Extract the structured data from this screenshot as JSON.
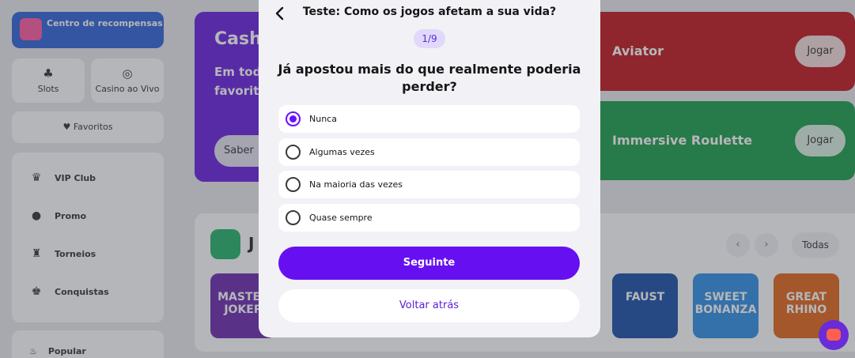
{
  "sidebar": {
    "rewards_label": "Centro de recompensas",
    "tiles": [
      {
        "label": "Slots",
        "icon": "cherries-icon"
      },
      {
        "label": "Casino ao Vivo",
        "icon": "chip-icon"
      }
    ],
    "favorites_label": "Favoritos",
    "menu": [
      {
        "label": "VIP Club",
        "icon": "crown-icon"
      },
      {
        "label": "Promo",
        "icon": "promo-icon"
      },
      {
        "label": "Torneios",
        "icon": "trophy-icon"
      },
      {
        "label": "Conquistas",
        "icon": "achievement-icon"
      }
    ],
    "popular_label": "Popular"
  },
  "promo": {
    "title": "Cash",
    "subtitle": "Em tod favorit",
    "button": "Saber"
  },
  "banners": [
    {
      "name": "Aviator",
      "play": "Jogar",
      "color": "#c2171d"
    },
    {
      "name": "Immersive Roulette",
      "play": "Jogar",
      "color": "#1a9e4b"
    }
  ],
  "games_row": {
    "title": "J",
    "all_label": "Todas",
    "prev": "‹",
    "next": "›",
    "thumbs": [
      {
        "label": "MASTER JOKER",
        "color": "#6b2bb0"
      },
      {
        "label": "FAUST",
        "color": "#1b4fa8"
      },
      {
        "label": "SWEET BONANZA",
        "color": "#2f8ee6"
      },
      {
        "label": "GREAT RHINO",
        "color": "#e2671b"
      }
    ]
  },
  "quiz": {
    "title": "Teste: Como os jogos afetam a sua vida?",
    "counter": "1/9",
    "question": "Já apostou mais do que realmente poderia perder?",
    "options": [
      "Nunca",
      "Algumas vezes",
      "Na maioria das vezes",
      "Quase sempre"
    ],
    "selected_index": 0,
    "next_label": "Seguinte",
    "back_label": "Voltar atrás",
    "accent": "#6610f2"
  }
}
